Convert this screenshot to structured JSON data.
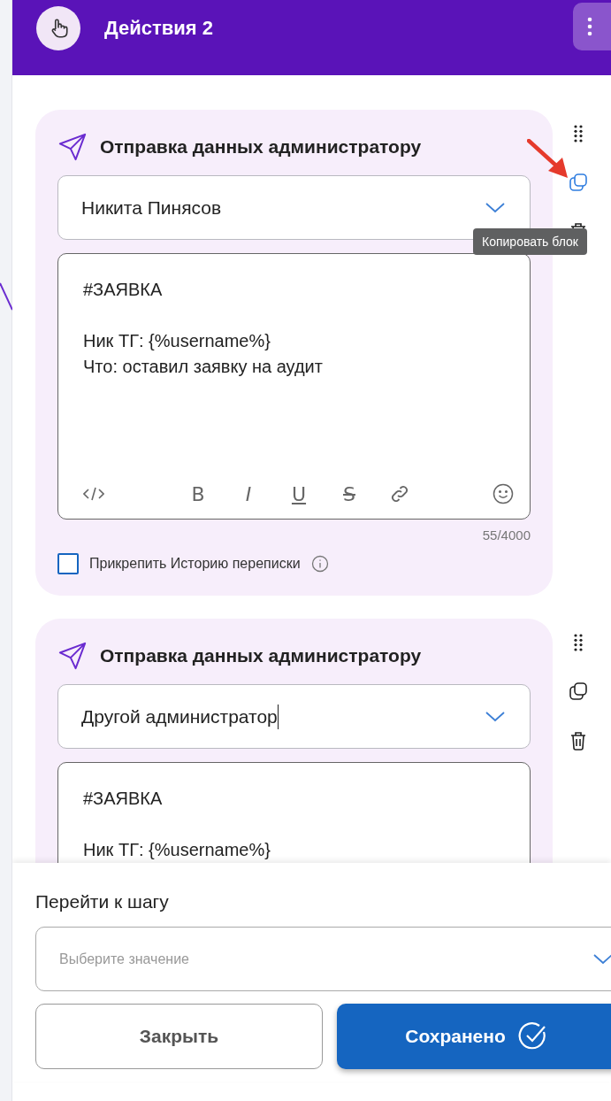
{
  "header": {
    "title": "Действия 2"
  },
  "blocks": [
    {
      "title": "Отправка данных администратору",
      "recipient": "Никита Пинясов",
      "cursor": false,
      "message": "#ЗАЯВКА\n\nНик ТГ: {%username%}\nЧто: оставил заявку на аудит",
      "counter": "55/4000",
      "attach": {
        "label": "Прикрепить Историю переписки",
        "checked": false
      },
      "copy_highlighted": true,
      "tooltip": "Копировать блок"
    },
    {
      "title": "Отправка данных администратору",
      "recipient": "Другой администратор",
      "cursor": true,
      "message": "#ЗАЯВКА\n\nНик ТГ: {%username%}",
      "copy_highlighted": false
    }
  ],
  "toolbar": [
    {
      "kind": "code"
    },
    {
      "kind": "bold",
      "label": "B"
    },
    {
      "kind": "italic",
      "label": "I"
    },
    {
      "kind": "underline",
      "label": "U"
    },
    {
      "kind": "strike",
      "label": "S"
    },
    {
      "kind": "link"
    },
    {
      "kind": "emoji"
    }
  ],
  "goto": {
    "label": "Перейти к шагу",
    "placeholder": "Выберите значение"
  },
  "buttons": [
    {
      "label": "Закрыть",
      "kind": "secondary"
    },
    {
      "label": "Сохранено",
      "kind": "primary"
    }
  ]
}
